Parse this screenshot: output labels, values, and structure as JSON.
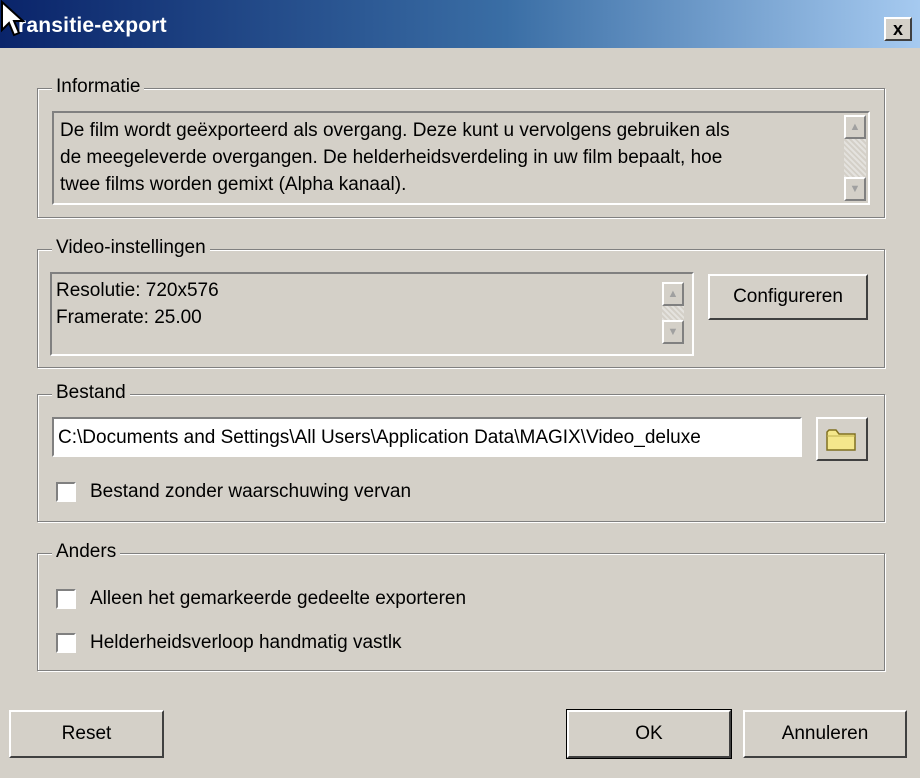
{
  "window": {
    "title": "ransitie-export",
    "close_label": "x"
  },
  "informatie": {
    "label": "Informatie",
    "lines": [
      "De film wordt geëxporteerd als overgang. Deze kunt u vervolgens gebruiken als",
      "de meegeleverde overgangen. De helderheidsverdeling in uw film bepaalt, hoe",
      "twee films worden gemixt (Alpha kanaal)."
    ]
  },
  "video": {
    "label": "Video-instellingen",
    "lines": [
      "Resolutie: 720x576",
      "Framerate: 25.00"
    ],
    "configure_label": "Configureren"
  },
  "bestand": {
    "label": "Bestand",
    "path_value": "C:\\Documents and Settings\\All Users\\Application Data\\MAGIX\\Video_deluxe",
    "overwrite_label": "Bestand zonder waarschuwing vervan",
    "overwrite_checked": false
  },
  "anders": {
    "label": "Anders",
    "export_selection_label": "Alleen het gemarkeerde gedeelte exporteren",
    "export_selection_checked": false,
    "manual_brightness_label": "Helderheidsverloop handmatig vastlĸ",
    "manual_brightness_checked": false
  },
  "footer": {
    "reset_label": "Reset",
    "ok_label": "OK",
    "cancel_label": "Annuleren"
  },
  "icons": {
    "cursor": "arrow-cursor-icon",
    "folder": "folder-icon",
    "scroll_up": "scroll-up-icon",
    "scroll_down": "scroll-down-icon"
  }
}
